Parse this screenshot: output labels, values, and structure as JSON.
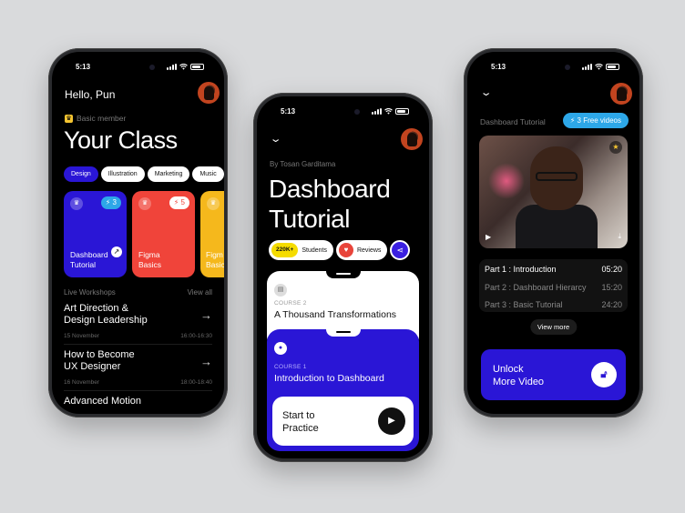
{
  "colors": {
    "accent_blue": "#2a16d6",
    "red": "#f0443a",
    "yellow": "#f5b81c",
    "free_badge": "#2da7e8",
    "stat_badge": "#f5dc00"
  },
  "phone1": {
    "time": "5:13",
    "greeting": "Hello, Pun",
    "member_label": "Basic member",
    "title": "Your Class",
    "chips": [
      {
        "label": "Design",
        "active": true
      },
      {
        "label": "Illustration",
        "active": false
      },
      {
        "label": "Marketing",
        "active": false
      },
      {
        "label": "Music",
        "active": false
      }
    ],
    "cards": [
      {
        "label1": "Dashboard",
        "label2": "Tutorial",
        "count": "3",
        "color": "#2a16d6",
        "pill_color": "#2da7e8",
        "pill_text_color": "#ffffff"
      },
      {
        "label1": "Figma",
        "label2": "Basics",
        "count": "5",
        "color": "#f0443a",
        "pill_color": "#ffffff",
        "pill_text_color": "#f0443a"
      },
      {
        "label1": "Figm",
        "label2": "Basic",
        "count": "",
        "color": "#f5b81c",
        "pill_color": "#ffffff",
        "pill_text_color": "#111111"
      }
    ],
    "live_label": "Live Workshops",
    "view_all": "View all",
    "workshops": [
      {
        "title1": "Art Direction &",
        "title2": "Design Leadership",
        "date": "15 November",
        "time": "16:00-16:30"
      },
      {
        "title1": "How to Become",
        "title2": "UX Designer",
        "date": "16 November",
        "time": "18:00-18:40"
      },
      {
        "title1": "Advanced Motion",
        "title2": "",
        "date": "",
        "time": ""
      }
    ]
  },
  "phone2": {
    "time": "5:13",
    "byline": "By Tosan Garditama",
    "title1": "Dashboard",
    "title2": "Tutorial",
    "students_count": "220K+",
    "students_label": "Students",
    "reviews_label": "Reviews",
    "course2_tag": "COURSE 2",
    "course2_name": "A Thousand Transformations",
    "course1_tag": "COURSE 1",
    "course1_name": "Introduction to Dashboard",
    "start1": "Start to",
    "start2": "Practice"
  },
  "phone3": {
    "time": "5:13",
    "section": "Dashboard Tutorial",
    "free_videos": "3 Free videos",
    "parts": [
      {
        "title": "Part 1  : Introduction",
        "duration": "05:20",
        "active": true
      },
      {
        "title": "Part 2  : Dashboard Hierarcy",
        "duration": "15:20",
        "active": false
      },
      {
        "title": "Part 3  : Basic Tutorial",
        "duration": "24:20",
        "active": false
      }
    ],
    "view_more": "View more",
    "unlock1": "Unlock",
    "unlock2": "More Video"
  }
}
